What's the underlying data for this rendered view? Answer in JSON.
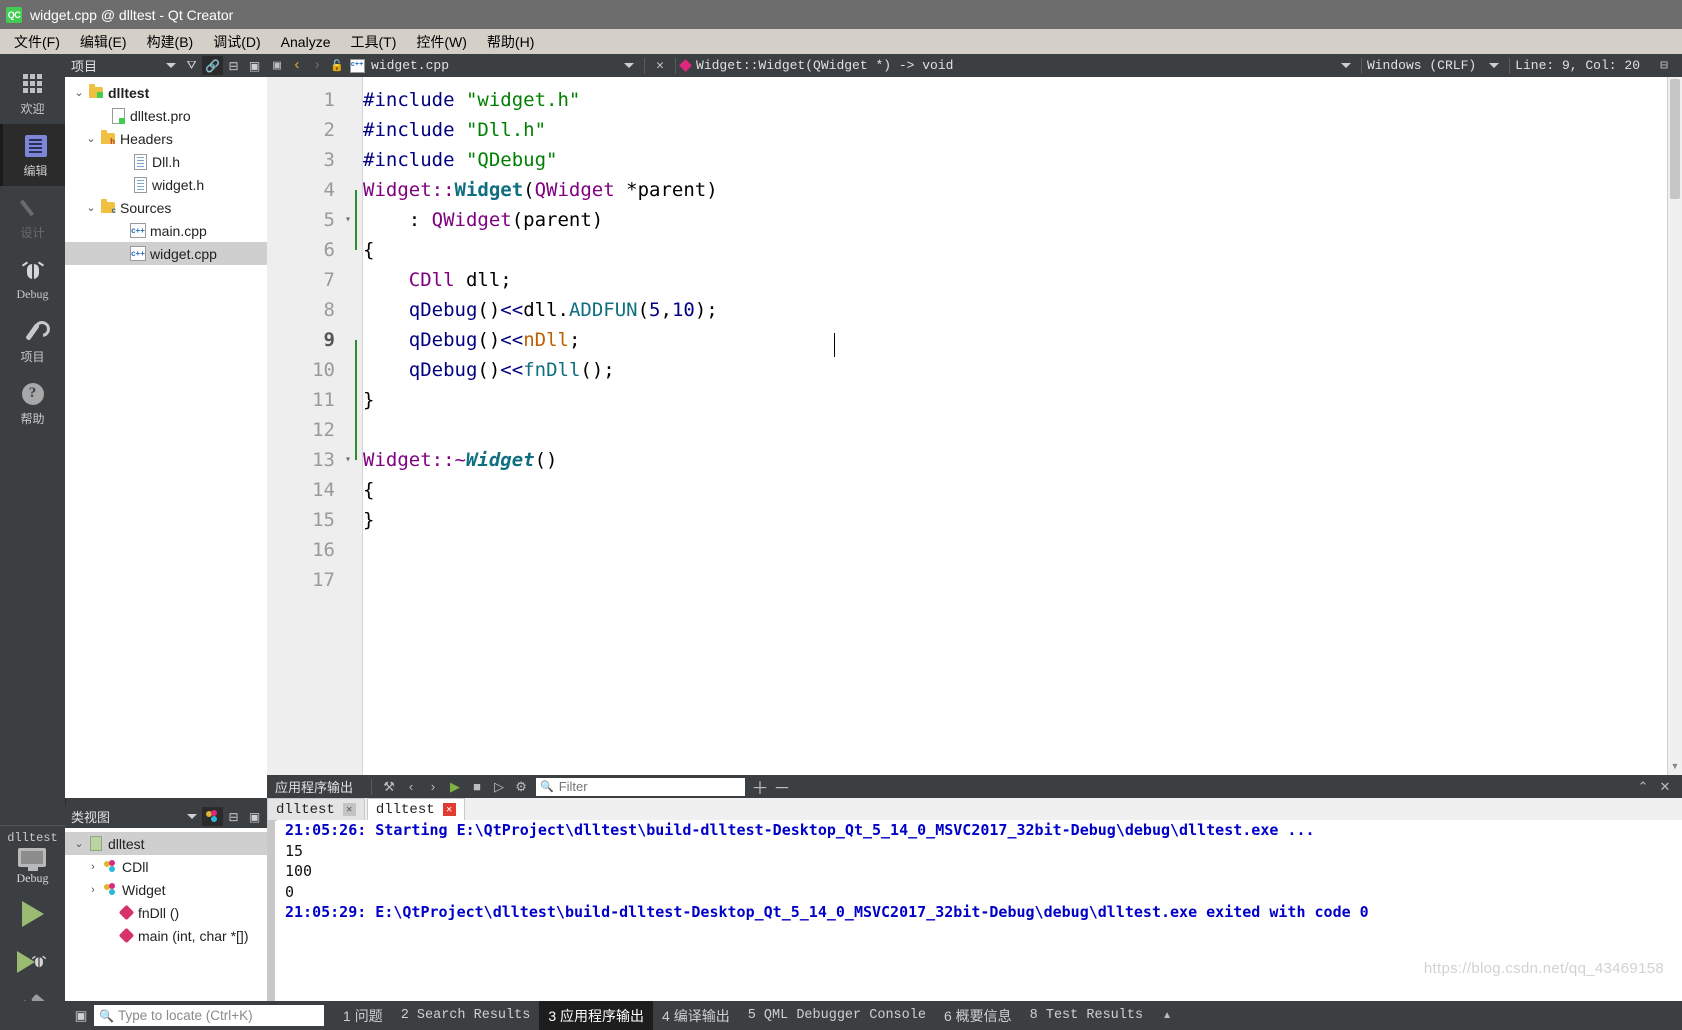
{
  "window": {
    "title": "widget.cpp @ dlltest - Qt Creator",
    "logo_text": "QC"
  },
  "menubar": {
    "items": [
      {
        "label": "文件(F)",
        "name": "menu-file"
      },
      {
        "label": "编辑(E)",
        "name": "menu-edit"
      },
      {
        "label": "构建(B)",
        "name": "menu-build"
      },
      {
        "label": "调试(D)",
        "name": "menu-debug"
      },
      {
        "label": "Analyze",
        "name": "menu-analyze"
      },
      {
        "label": "工具(T)",
        "name": "menu-tools"
      },
      {
        "label": "控件(W)",
        "name": "menu-window"
      },
      {
        "label": "帮助(H)",
        "name": "menu-help"
      }
    ]
  },
  "modebar": {
    "items": [
      {
        "label": "欢迎",
        "icon": "grid-icon",
        "state": "normal"
      },
      {
        "label": "编辑",
        "icon": "document-icon",
        "state": "active"
      },
      {
        "label": "设计",
        "icon": "pencil-icon",
        "state": "disabled"
      },
      {
        "label": "Debug",
        "icon": "bug-icon",
        "state": "normal"
      },
      {
        "label": "项目",
        "icon": "wrench-icon",
        "state": "normal"
      },
      {
        "label": "帮助",
        "icon": "question-mark-icon",
        "state": "normal"
      }
    ],
    "run_controls": {
      "kit_name": "dlltest",
      "kit_config": "Debug",
      "run_label": "Run",
      "debug_label": "Start Debugging",
      "build_label": "Build"
    }
  },
  "project_panel": {
    "header_title": "项目",
    "tree": [
      {
        "label": "dlltest",
        "indent": 0,
        "arrow": "down",
        "icon": "folder-qt-icon",
        "bold": true,
        "selected": false
      },
      {
        "label": "dlltest.pro",
        "indent": 1,
        "arrow": "none",
        "icon": "pro-file-icon",
        "bold": false,
        "selected": false
      },
      {
        "label": "Headers",
        "indent": 1,
        "arrow": "down",
        "icon": "folder-h-icon",
        "bold": false,
        "selected": false
      },
      {
        "label": "Dll.h",
        "indent": 2,
        "arrow": "none",
        "icon": "header-file-icon",
        "bold": false,
        "selected": false
      },
      {
        "label": "widget.h",
        "indent": 2,
        "arrow": "none",
        "icon": "header-file-icon",
        "bold": false,
        "selected": false
      },
      {
        "label": "Sources",
        "indent": 1,
        "arrow": "down",
        "icon": "folder-cpp-icon",
        "bold": false,
        "selected": false
      },
      {
        "label": "main.cpp",
        "indent": 2,
        "arrow": "none",
        "icon": "cpp-file-icon",
        "bold": false,
        "selected": false
      },
      {
        "label": "widget.cpp",
        "indent": 2,
        "arrow": "none",
        "icon": "cpp-file-icon",
        "bold": false,
        "selected": true
      }
    ]
  },
  "class_panel": {
    "header_title": "类视图",
    "tree": [
      {
        "label": "dlltest",
        "indent": 0,
        "arrow": "down",
        "icon": "project-icon",
        "selected": true
      },
      {
        "label": "CDll",
        "indent": 1,
        "arrow": "right",
        "icon": "class-icon",
        "selected": false
      },
      {
        "label": "Widget",
        "indent": 1,
        "arrow": "right",
        "icon": "class-icon",
        "selected": false
      },
      {
        "label": "fnDll ()",
        "indent": 2,
        "arrow": "none",
        "icon": "function-icon",
        "selected": false
      },
      {
        "label": "main (int, char *[])",
        "indent": 2,
        "arrow": "none",
        "icon": "function-icon",
        "selected": false
      }
    ]
  },
  "editor_toolbar": {
    "filename": "widget.cpp",
    "symbol": "Widget::Widget(QWidget *) -> void",
    "line_ending": "Windows (CRLF)",
    "cursor_position": "Line: 9, Col: 20"
  },
  "editor": {
    "current_line": 9,
    "lines": [
      {
        "n": 1,
        "fold": "",
        "tokens": [
          {
            "t": "#include ",
            "c": "k-pre"
          },
          {
            "t": "\"widget.h\"",
            "c": "k-str"
          }
        ]
      },
      {
        "n": 2,
        "fold": "",
        "tokens": [
          {
            "t": "#include ",
            "c": "k-pre"
          },
          {
            "t": "\"Dll.h\"",
            "c": "k-str"
          }
        ]
      },
      {
        "n": 3,
        "fold": "",
        "tokens": [
          {
            "t": "#include ",
            "c": "k-pre"
          },
          {
            "t": "\"QDebug\"",
            "c": "k-str"
          }
        ]
      },
      {
        "n": 4,
        "fold": "",
        "tokens": [
          {
            "t": "Widget::",
            "c": "k-cls"
          },
          {
            "t": "Widget",
            "c": "k-fnv"
          },
          {
            "t": "(",
            "c": "k-plain"
          },
          {
            "t": "QWidget",
            "c": "k-cls"
          },
          {
            "t": " *parent)",
            "c": "k-plain"
          }
        ]
      },
      {
        "n": 5,
        "fold": "▾",
        "tokens": [
          {
            "t": "    : ",
            "c": "k-plain"
          },
          {
            "t": "QWidget",
            "c": "k-cls"
          },
          {
            "t": "(parent)",
            "c": "k-plain"
          }
        ]
      },
      {
        "n": 6,
        "fold": "",
        "tokens": [
          {
            "t": "{",
            "c": "k-plain"
          }
        ]
      },
      {
        "n": 7,
        "fold": "",
        "tokens": [
          {
            "t": "    ",
            "c": "k-plain"
          },
          {
            "t": "CDll",
            "c": "k-cls"
          },
          {
            "t": " dll;",
            "c": "k-plain"
          }
        ]
      },
      {
        "n": 8,
        "fold": "",
        "tokens": [
          {
            "t": "    ",
            "c": "k-plain"
          },
          {
            "t": "qDebug",
            "c": "k-op"
          },
          {
            "t": "()",
            "c": "k-plain"
          },
          {
            "t": "<<",
            "c": "k-op"
          },
          {
            "t": "dll.",
            "c": "k-plain"
          },
          {
            "t": "ADDFUN",
            "c": "k-fn"
          },
          {
            "t": "(",
            "c": "k-plain"
          },
          {
            "t": "5",
            "c": "k-op"
          },
          {
            "t": ",",
            "c": "k-plain"
          },
          {
            "t": "10",
            "c": "k-op"
          },
          {
            "t": ");",
            "c": "k-plain"
          }
        ]
      },
      {
        "n": 9,
        "fold": "",
        "tokens": [
          {
            "t": "    ",
            "c": "k-plain"
          },
          {
            "t": "qDebug",
            "c": "k-op"
          },
          {
            "t": "()",
            "c": "k-plain"
          },
          {
            "t": "<<",
            "c": "k-op"
          },
          {
            "t": "nDll",
            "c": "k-var"
          },
          {
            "t": ";",
            "c": "k-plain"
          }
        ]
      },
      {
        "n": 10,
        "fold": "",
        "tokens": [
          {
            "t": "    ",
            "c": "k-plain"
          },
          {
            "t": "qDebug",
            "c": "k-op"
          },
          {
            "t": "()",
            "c": "k-plain"
          },
          {
            "t": "<<",
            "c": "k-op"
          },
          {
            "t": "fnDll",
            "c": "k-fn"
          },
          {
            "t": "();",
            "c": "k-plain"
          }
        ]
      },
      {
        "n": 11,
        "fold": "",
        "tokens": [
          {
            "t": "}",
            "c": "k-plain"
          }
        ]
      },
      {
        "n": 12,
        "fold": "",
        "tokens": []
      },
      {
        "n": 13,
        "fold": "▾",
        "tokens": [
          {
            "t": "Widget::~",
            "c": "k-cls"
          },
          {
            "t": "Widget",
            "c": "k-fnvi"
          },
          {
            "t": "()",
            "c": "k-plain"
          }
        ]
      },
      {
        "n": 14,
        "fold": "",
        "tokens": [
          {
            "t": "{",
            "c": "k-plain"
          }
        ]
      },
      {
        "n": 15,
        "fold": "",
        "tokens": [
          {
            "t": "}",
            "c": "k-plain"
          }
        ]
      },
      {
        "n": 16,
        "fold": "",
        "tokens": []
      },
      {
        "n": 17,
        "fold": "",
        "tokens": []
      }
    ]
  },
  "output_pane": {
    "title": "应用程序输出",
    "filter_placeholder": "Filter",
    "filter_value": "",
    "tabs": [
      {
        "label": "dlltest",
        "active": false
      },
      {
        "label": "dlltest",
        "active": true
      }
    ],
    "lines": [
      {
        "text": "21:05:26: Starting E:\\QtProject\\dlltest\\build-dlltest-Desktop_Qt_5_14_0_MSVC2017_32bit-Debug\\debug\\dlltest.exe ...",
        "kind": "msg"
      },
      {
        "text": "15",
        "kind": "plain"
      },
      {
        "text": "100",
        "kind": "plain"
      },
      {
        "text": "0",
        "kind": "plain"
      },
      {
        "text": "21:05:29: E:\\QtProject\\dlltest\\build-dlltest-Desktop_Qt_5_14_0_MSVC2017_32bit-Debug\\debug\\dlltest.exe exited with code 0",
        "kind": "msg"
      }
    ],
    "watermark": "https://blog.csdn.net/qq_43469158"
  },
  "statusbar": {
    "locator_placeholder": "Type to locate (Ctrl+K)",
    "panes": [
      {
        "num": "1",
        "label": "问题",
        "cn": true,
        "active": false
      },
      {
        "num": "2",
        "label": "Search Results",
        "cn": false,
        "active": false
      },
      {
        "num": "3",
        "label": "应用程序输出",
        "cn": true,
        "active": true
      },
      {
        "num": "4",
        "label": "编译输出",
        "cn": true,
        "active": false
      },
      {
        "num": "5",
        "label": "QML Debugger Console",
        "cn": false,
        "active": false
      },
      {
        "num": "6",
        "label": "概要信息",
        "cn": true,
        "active": false
      },
      {
        "num": "8",
        "label": "Test Results",
        "cn": false,
        "active": false
      }
    ]
  },
  "colors": {
    "titlebar": "#6d6d6d",
    "menubar": "#d4d0c8",
    "chrome_dark": "#3c3f41",
    "accent_green": "#41cd52",
    "run_green": "#9bbb72",
    "output_blue": "#0000c8"
  }
}
